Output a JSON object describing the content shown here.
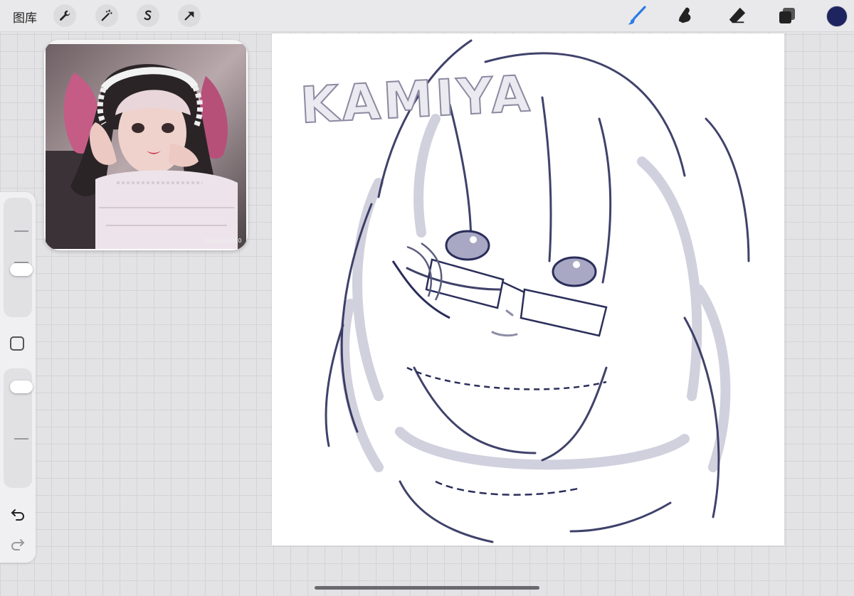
{
  "topbar": {
    "gallery_label": "图库",
    "left_tools": [
      "wrench-icon",
      "magic-wand-icon",
      "selection-s-icon",
      "transform-arrow-icon"
    ],
    "right_tools": [
      "brush-icon",
      "smudge-icon",
      "eraser-icon",
      "layers-icon"
    ],
    "brush_active_color": "#2c7be5",
    "current_color": "#1e2460"
  },
  "reference": {
    "watermark": "@dada16080"
  },
  "sidebar": {
    "size_slider_level": 0.38,
    "opacity_slider_level": 0.92,
    "undo_icon": "undo-icon",
    "redo_icon": "redo-icon"
  },
  "canvas": {
    "title_text": "KAMIYA",
    "stroke_color": "#2b2e5a",
    "shade_color": "#c9c8d8"
  }
}
